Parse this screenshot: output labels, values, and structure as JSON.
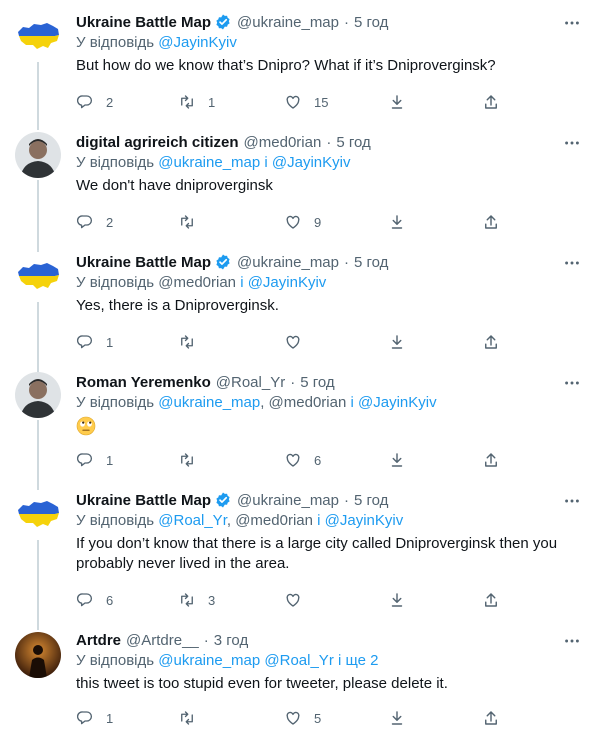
{
  "reply_prefix": "У відповідь",
  "tweets": [
    {
      "name": "Ukraine Battle Map",
      "verified": true,
      "handle": "@ukraine_map",
      "time": "5 год",
      "reply_to": [
        {
          "t": "@JayinKyiv",
          "link": true
        }
      ],
      "text": [
        "But how do we know that’s Dnipro? What if it’s Dniproverginsk?"
      ],
      "counts": {
        "reply": "2",
        "retweet": "1",
        "like": "15"
      },
      "avatar": "ukraine-map-avatar"
    },
    {
      "name": "digital agrireich citizen",
      "verified": false,
      "handle": "@med0rian",
      "time": "5 год",
      "reply_to": [
        {
          "t": "@ukraine_map",
          "link": true
        },
        {
          "t": " і ",
          "link": true
        },
        {
          "t": "@JayinKyiv",
          "link": true
        }
      ],
      "text": [
        "We don't have dniproverginsk"
      ],
      "counts": {
        "reply": "2",
        "retweet": "",
        "like": "9"
      },
      "avatar": "person-avatar"
    },
    {
      "name": "Ukraine Battle Map",
      "verified": true,
      "handle": "@ukraine_map",
      "time": "5 год",
      "reply_to": [
        {
          "t": "@med0rian",
          "link": false
        },
        {
          "t": " і ",
          "link": true
        },
        {
          "t": "@JayinKyiv",
          "link": true
        }
      ],
      "text": [
        "Yes, there is a Dniproverginsk."
      ],
      "counts": {
        "reply": "1",
        "retweet": "",
        "like": ""
      },
      "avatar": "ukraine-map-avatar"
    },
    {
      "name": "Roman Yeremenko",
      "verified": false,
      "handle": "@Roal_Yr",
      "time": "5 год",
      "reply_to": [
        {
          "t": "@ukraine_map",
          "link": true
        },
        {
          "t": ", @med0rian",
          "link": false
        },
        {
          "t": " і ",
          "link": true
        },
        {
          "t": "@JayinKyiv",
          "link": true
        }
      ],
      "text": [],
      "emoji": "rolling-eyes-emoji",
      "counts": {
        "reply": "1",
        "retweet": "",
        "like": "6"
      },
      "avatar": "person-avatar"
    },
    {
      "name": "Ukraine Battle Map",
      "verified": true,
      "handle": "@ukraine_map",
      "time": "5 год",
      "reply_to": [
        {
          "t": "@Roal_Yr",
          "link": true
        },
        {
          "t": ", @med0rian",
          "link": false
        },
        {
          "t": " і ",
          "link": true
        },
        {
          "t": "@JayinKyiv",
          "link": true
        }
      ],
      "text": [
        "If you don’t know that there is a large city called Dniproverginsk then you",
        "probably never lived in the area."
      ],
      "counts": {
        "reply": "6",
        "retweet": "3",
        "like": ""
      },
      "avatar": "ukraine-map-avatar"
    },
    {
      "name": "Artdre",
      "verified": false,
      "handle": "@Artdre__",
      "time": "3 год",
      "reply_to": [
        {
          "t": "@ukraine_map",
          "link": true
        },
        {
          "t": " ",
          "link": false
        },
        {
          "t": "@Roal_Yr",
          "link": true
        },
        {
          "t": " і ще 2",
          "link": true
        }
      ],
      "text": [
        "this tweet is too stupid even for tweeter, please delete it."
      ],
      "counts": {
        "reply": "1",
        "retweet": "",
        "like": "5"
      },
      "avatar": "artdre-avatar"
    }
  ],
  "colors": {
    "accent": "#1d9bf0",
    "muted": "#536471",
    "thread": "#cfd9de",
    "ukraine_blue": "#2a63d4",
    "ukraine_yellow": "#f5d20b"
  }
}
